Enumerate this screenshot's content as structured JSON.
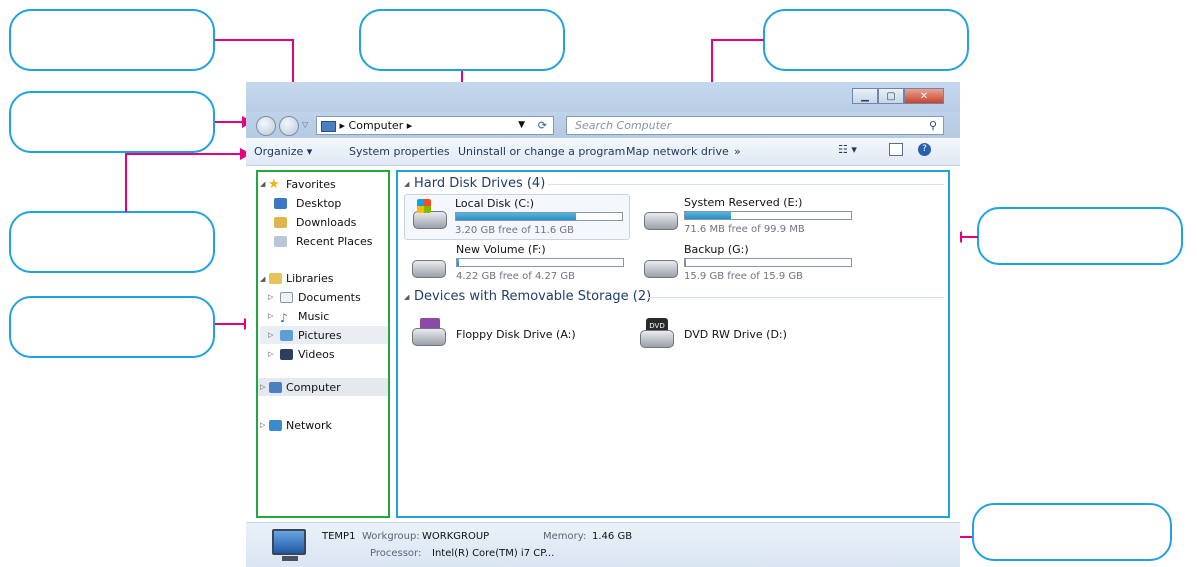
{
  "address": {
    "root_label": "Computer",
    "refresh": "⟳"
  },
  "search": {
    "placeholder": "Search Computer"
  },
  "toolbar": {
    "organize": "Organize ▾",
    "system_properties": "System properties",
    "uninstall": "Uninstall or change a program",
    "map_drive": "Map network drive",
    "more": "»"
  },
  "nav": {
    "favorites": "Favorites",
    "desktop": "Desktop",
    "downloads": "Downloads",
    "recent": "Recent Places",
    "libraries": "Libraries",
    "documents": "Documents",
    "music": "Music",
    "pictures": "Pictures",
    "videos": "Videos",
    "computer": "Computer",
    "network": "Network"
  },
  "groups": {
    "hdd": "Hard Disk Drives (4)",
    "removable": "Devices with Removable Storage (2)"
  },
  "drives": [
    {
      "name": "Local Disk (C:)",
      "free": "3.20 GB free of 11.6 GB",
      "used_fraction": 0.72
    },
    {
      "name": "System Reserved (E:)",
      "free": "71.6 MB free of 99.9 MB",
      "used_fraction": 0.28
    },
    {
      "name": "New Volume (F:)",
      "free": "4.22 GB free of 4.27 GB",
      "used_fraction": 0.01
    },
    {
      "name": "Backup (G:)",
      "free": "15.9 GB free of 15.9 GB",
      "used_fraction": 0.005
    }
  ],
  "removable": [
    {
      "name": "Floppy Disk Drive (A:)"
    },
    {
      "name": "DVD RW Drive (D:)",
      "badge": "DVD"
    }
  ],
  "details": {
    "computer_name": "TEMP1",
    "workgroup_label": "Workgroup:",
    "workgroup_value": "WORKGROUP",
    "memory_label": "Memory:",
    "memory_value": "1.46 GB",
    "processor_label": "Processor:",
    "processor_value": "Intel(R) Core(TM) i7 CP..."
  },
  "colors": {
    "callout_border": "#1fa3dc",
    "arrow": "#e6007e",
    "nav_frame": "#22a93e",
    "content_frame": "#1fa3dc"
  }
}
